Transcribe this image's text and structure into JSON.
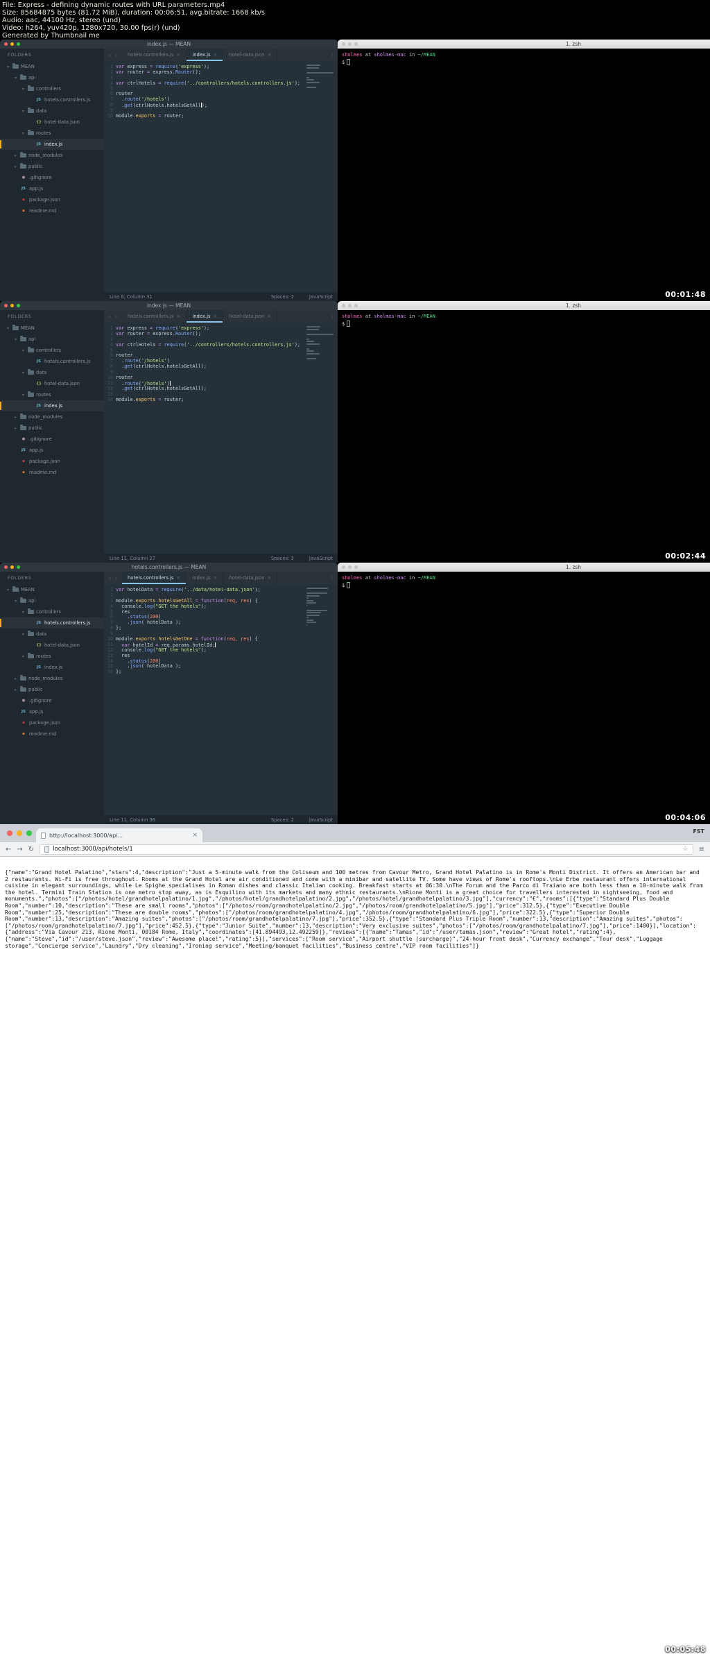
{
  "header": {
    "lines": [
      "File: Express - defining dynamic routes with URL parameters.mp4",
      "Size: 85684875 bytes (81.72 MiB), duration: 00:06:51, avg.bitrate: 1668 kb/s",
      "Audio: aac, 44100 Hz, stereo (und)",
      "Video: h264, yuv420p, 1280x720, 30.00 fps(r) (und)",
      "Generated by Thumbnail me"
    ]
  },
  "colors": {
    "accent_tab_underline": "#88c5e8",
    "selection_marker": "#f7b125",
    "keyword": "#c792ea",
    "string": "#c3e88d",
    "function": "#82aaff",
    "terminal_user": "#ff6ac1",
    "terminal_path": "#5fd78e"
  },
  "sidebar": {
    "header": "FOLDERS",
    "items": [
      {
        "label": "MEAN",
        "type": "folder-open",
        "depth": 0
      },
      {
        "label": "api",
        "type": "folder-open",
        "depth": 1
      },
      {
        "label": "controllers",
        "type": "folder-open",
        "depth": 2
      },
      {
        "label": "hotels.controllers.js",
        "type": "js",
        "depth": 3
      },
      {
        "label": "data",
        "type": "folder-open",
        "depth": 2
      },
      {
        "label": "hotel-data.json",
        "type": "json",
        "depth": 3
      },
      {
        "label": "routes",
        "type": "folder-open",
        "depth": 2
      },
      {
        "label": "index.js",
        "type": "js",
        "depth": 3
      },
      {
        "label": "node_modules",
        "type": "folder",
        "depth": 1
      },
      {
        "label": "public",
        "type": "folder",
        "depth": 1
      },
      {
        "label": ".gitignore",
        "type": "git",
        "depth": 1
      },
      {
        "label": "app.js",
        "type": "js",
        "depth": 1
      },
      {
        "label": "package.json",
        "type": "npm",
        "depth": 1
      },
      {
        "label": "readme.md",
        "type": "md",
        "depth": 1
      }
    ],
    "icon_glyphs": {
      "js": {
        "glyph": "JS",
        "color": "#6cb2c7"
      },
      "json": {
        "glyph": "{}",
        "color": "#b8b25a"
      },
      "git": {
        "glyph": "●",
        "color": "#9f8a9d"
      },
      "npm": {
        "glyph": "▪",
        "color": "#cc3e44"
      },
      "md": {
        "glyph": "▪",
        "color": "#e37933"
      }
    }
  },
  "terminal": {
    "title": "1. zsh",
    "lines": [
      [
        [
          "user",
          "sholmes"
        ],
        [
          "dim",
          " at "
        ],
        [
          "host",
          "sholmes-mac"
        ],
        [
          "dim",
          " in "
        ],
        [
          "path",
          "~/MEAN"
        ]
      ],
      [
        [
          "pl",
          "$"
        ],
        [
          "cursor",
          ""
        ]
      ]
    ]
  },
  "frames": [
    {
      "timestamp": "00:01:48",
      "window_title": "index.js — MEAN",
      "active_tab": "index.js",
      "selected_file": "index.js",
      "tabs": [
        "hotels.controllers.js",
        "index.js",
        "hotel-data.json"
      ],
      "status": {
        "position": "Line 8, Column 31",
        "spaces": "Spaces: 2",
        "lang": "JavaScript"
      },
      "code": [
        [
          [
            "kw",
            "var"
          ],
          [
            "pl",
            " express "
          ],
          [
            "op",
            "="
          ],
          [
            "pl",
            " "
          ],
          [
            "fn",
            "require"
          ],
          [
            "pl",
            "("
          ],
          [
            "str",
            "'express'"
          ],
          [
            "pl",
            ");"
          ]
        ],
        [
          [
            "kw",
            "var"
          ],
          [
            "pl",
            " router "
          ],
          [
            "op",
            "="
          ],
          [
            "pl",
            " express."
          ],
          [
            "fn",
            "Router"
          ],
          [
            "pl",
            "();"
          ]
        ],
        [],
        [
          [
            "kw",
            "var"
          ],
          [
            "pl",
            " ctrlHotels "
          ],
          [
            "op",
            "="
          ],
          [
            "pl",
            " "
          ],
          [
            "fn",
            "require"
          ],
          [
            "pl",
            "("
          ],
          [
            "str",
            "'../controllers/hotels.controllers.js'"
          ],
          [
            "pl",
            ");"
          ]
        ],
        [],
        [
          [
            "pl",
            "router"
          ]
        ],
        [
          [
            "pl",
            "  ."
          ],
          [
            "fn",
            "route"
          ],
          [
            "pl",
            "("
          ],
          [
            "str",
            "'/hotels'"
          ],
          [
            "pl",
            ")"
          ]
        ],
        [
          [
            "pl",
            "  ."
          ],
          [
            "fn",
            "get"
          ],
          [
            "pl",
            "(ctrlHotels.hotelsGetAll"
          ],
          [
            "caret",
            ""
          ],
          [
            "pl",
            ");"
          ]
        ],
        [],
        [
          [
            "pl",
            "module."
          ],
          [
            "yd",
            "exports"
          ],
          [
            "pl",
            " "
          ],
          [
            "op",
            "="
          ],
          [
            "pl",
            " router;"
          ]
        ]
      ]
    },
    {
      "timestamp": "00:02:44",
      "window_title": "index.js — MEAN",
      "active_tab": "index.js",
      "selected_file": "index.js",
      "tabs": [
        "hotels.controllers.js",
        "index.js",
        "hotel-data.json"
      ],
      "status": {
        "position": "Line 11, Column 27",
        "spaces": "Spaces: 2",
        "lang": "JavaScript"
      },
      "code": [
        [
          [
            "kw",
            "var"
          ],
          [
            "pl",
            " express "
          ],
          [
            "op",
            "="
          ],
          [
            "pl",
            " "
          ],
          [
            "fn",
            "require"
          ],
          [
            "pl",
            "("
          ],
          [
            "str",
            "'express'"
          ],
          [
            "pl",
            ");"
          ]
        ],
        [
          [
            "kw",
            "var"
          ],
          [
            "pl",
            " router "
          ],
          [
            "op",
            "="
          ],
          [
            "pl",
            " express."
          ],
          [
            "fn",
            "Router"
          ],
          [
            "pl",
            "();"
          ]
        ],
        [],
        [
          [
            "kw",
            "var"
          ],
          [
            "pl",
            " ctrlHotels "
          ],
          [
            "op",
            "="
          ],
          [
            "pl",
            " "
          ],
          [
            "fn",
            "require"
          ],
          [
            "pl",
            "("
          ],
          [
            "str",
            "'../controllers/hotels.controllers.js'"
          ],
          [
            "pl",
            ");"
          ]
        ],
        [],
        [
          [
            "pl",
            "router"
          ]
        ],
        [
          [
            "pl",
            "  ."
          ],
          [
            "fn",
            "route"
          ],
          [
            "pl",
            "("
          ],
          [
            "str",
            "'/hotels'"
          ],
          [
            "pl",
            ")"
          ]
        ],
        [
          [
            "pl",
            "  ."
          ],
          [
            "fn",
            "get"
          ],
          [
            "pl",
            "(ctrlHotels.hotelsGetAll);"
          ]
        ],
        [],
        [
          [
            "pl",
            "router"
          ]
        ],
        [
          [
            "pl",
            "  ."
          ],
          [
            "fn",
            "route"
          ],
          [
            "pl",
            "("
          ],
          [
            "str",
            "'/hotels'"
          ],
          [
            "pl",
            ")"
          ],
          [
            "caret",
            ""
          ]
        ],
        [
          [
            "pl",
            "  ."
          ],
          [
            "fn",
            "get"
          ],
          [
            "pl",
            "(ctrlHotels.hotelsGetAll);"
          ]
        ],
        [],
        [
          [
            "pl",
            "module."
          ],
          [
            "yd",
            "exports"
          ],
          [
            "pl",
            " "
          ],
          [
            "op",
            "="
          ],
          [
            "pl",
            " router;"
          ]
        ]
      ]
    },
    {
      "timestamp": "00:04:06",
      "window_title": "hotels.controllers.js — MEAN",
      "active_tab": "hotels.controllers.js",
      "selected_file": "hotels.controllers.js",
      "tabs": [
        "hotels.controllers.js",
        "index.js",
        "hotel-data.json"
      ],
      "status": {
        "position": "Line 11, Column 36",
        "spaces": "Spaces: 2",
        "lang": "JavaScript"
      },
      "code": [
        [
          [
            "kw",
            "var"
          ],
          [
            "pl",
            " hotelData "
          ],
          [
            "op",
            "="
          ],
          [
            "pl",
            " "
          ],
          [
            "fn",
            "require"
          ],
          [
            "pl",
            "("
          ],
          [
            "str",
            "'../data/hotel-data.json'"
          ],
          [
            "pl",
            ");"
          ]
        ],
        [],
        [
          [
            "pl",
            "module."
          ],
          [
            "yd",
            "exports"
          ],
          [
            "pl",
            "."
          ],
          [
            "yd",
            "hotelsGetAll"
          ],
          [
            "pl",
            " "
          ],
          [
            "op",
            "="
          ],
          [
            "pl",
            " "
          ],
          [
            "kw",
            "function"
          ],
          [
            "pl",
            "("
          ],
          [
            "par",
            "req, res"
          ],
          [
            "pl",
            ") {"
          ]
        ],
        [
          [
            "pl",
            "  console."
          ],
          [
            "fn",
            "log"
          ],
          [
            "pl",
            "("
          ],
          [
            "str",
            "\"GET the hotels\""
          ],
          [
            "pl",
            ");"
          ]
        ],
        [
          [
            "pl",
            "  res"
          ]
        ],
        [
          [
            "pl",
            "    ."
          ],
          [
            "fn",
            "status"
          ],
          [
            "pl",
            "("
          ],
          [
            "num",
            "200"
          ],
          [
            "pl",
            ")"
          ]
        ],
        [
          [
            "pl",
            "    ."
          ],
          [
            "fn",
            "json"
          ],
          [
            "pl",
            "( hotelData );"
          ]
        ],
        [
          [
            "pl",
            "};"
          ]
        ],
        [],
        [
          [
            "pl",
            "module."
          ],
          [
            "yd",
            "exports"
          ],
          [
            "pl",
            "."
          ],
          [
            "yd",
            "hotelsGetOne"
          ],
          [
            "pl",
            " "
          ],
          [
            "op",
            "="
          ],
          [
            "pl",
            " "
          ],
          [
            "kw",
            "function"
          ],
          [
            "pl",
            "("
          ],
          [
            "par",
            "req, res"
          ],
          [
            "pl",
            ") {"
          ]
        ],
        [
          [
            "pl",
            "  "
          ],
          [
            "kw",
            "var"
          ],
          [
            "pl",
            " hotelId "
          ],
          [
            "op",
            "="
          ],
          [
            "pl",
            " req.params.hotelId;"
          ],
          [
            "caret",
            ""
          ]
        ],
        [
          [
            "pl",
            "  console."
          ],
          [
            "fn",
            "log"
          ],
          [
            "pl",
            "("
          ],
          [
            "str",
            "\"GET the hotels\""
          ],
          [
            "pl",
            ");"
          ]
        ],
        [
          [
            "pl",
            "  res"
          ]
        ],
        [
          [
            "pl",
            "    ."
          ],
          [
            "fn",
            "status"
          ],
          [
            "pl",
            "("
          ],
          [
            "num",
            "200"
          ],
          [
            "pl",
            ")"
          ]
        ],
        [
          [
            "pl",
            "    ."
          ],
          [
            "fn",
            "json"
          ],
          [
            "pl",
            "( hotelData );"
          ]
        ],
        [
          [
            "pl",
            "};"
          ]
        ]
      ]
    }
  ],
  "browser": {
    "tab_title": "http://localhost:3000/api...",
    "window_label": "FST",
    "url": "localhost:3000/api/hotels/1",
    "timestamp": "00:05:48",
    "json_body": "{\"name\":\"Grand Hotel Palatino\",\"stars\":4,\"description\":\"Just a 5-minute walk from the Coliseum and 100 metres from Cavour Metro, Grand Hotel Palatino is in Rome's Monti District. It offers an American bar and 2 restaurants. Wi-Fi is free throughout. Rooms at the Grand Hotel are air conditioned and come with a minibar and satellite TV. Some have views of Rome's rooftops.\\nLe Erbe restaurant offers international cuisine in elegant surroundings, while Le Spighe specialises in Roman dishes and classic Italian cooking. Breakfast starts at 06:30.\\nThe Forum and the Parco di Traiano are both less than a 10-minute walk from the hotel. Termini Train Station is one metro stop away, as is Esquilino with its markets and many ethnic restaurants.\\nRione Monti is a great choice for travellers interested in sightseeing, food and monuments.\",\"photos\":[\"/photos/hotel/grandhotelpalatino/1.jpg\",\"/photos/hotel/grandhotelpalatino/2.jpg\",\"/photos/hotel/grandhotelpalatino/3.jpg\"],\"currency\":\"€\",\"rooms\":[{\"type\":\"Standard Plus Double Room\",\"number\":10,\"description\":\"These are small rooms\",\"photos\":[\"/photos/room/grandhotelpalatino/2.jpg\",\"/photos/room/grandhotelpalatino/5.jpg\"],\"price\":312.5},{\"type\":\"Executive Double Room\",\"number\":25,\"description\":\"These are double rooms\",\"photos\":[\"/photos/room/grandhotelpalatino/4.jpg\",\"/photos/room/grandhotelpalatino/6.jpg\"],\"price\":322.5},{\"type\":\"Superior Double Room\",\"number\":13,\"description\":\"Amazing suites\",\"photos\":[\"/photos/room/grandhotelpalatino/7.jpg\"],\"price\":352.5},{\"type\":\"Standard Plus Triple Room\",\"number\":13,\"description\":\"Amazing suites\",\"photos\":[\"/photos/room/grandhotelpalatino/7.jpg\"],\"price\":452.5},{\"type\":\"Junior Suite\",\"number\":13,\"description\":\"Very exclusive suites\",\"photos\":[\"/photos/room/grandhotelpalatino/7.jpg\"],\"price\":1400}],\"location\":{\"address\":\"Via Cavour 213, Rione Monti, 00184 Rome, Italy\",\"coordinates\":[41.894493,12.492259]},\"reviews\":[{\"name\":\"Tamas\",\"id\":\"/user/tamas.json\",\"review\":\"Great hotel\",\"rating\":4},{\"name\":\"Steve\",\"id\":\"/user/steve.json\",\"review\":\"Awesome place!\",\"rating\":5}],\"services\":[\"Room service\",\"Airport shuttle (surcharge)\",\"24-hour front desk\",\"Currency exchange\",\"Tour desk\",\"Luggage storage\",\"Concierge service\",\"Laundry\",\"Dry cleaning\",\"Ironing service\",\"Meeting/banquet facilities\",\"Business centre\",\"VIP room facilities\"]}"
  }
}
